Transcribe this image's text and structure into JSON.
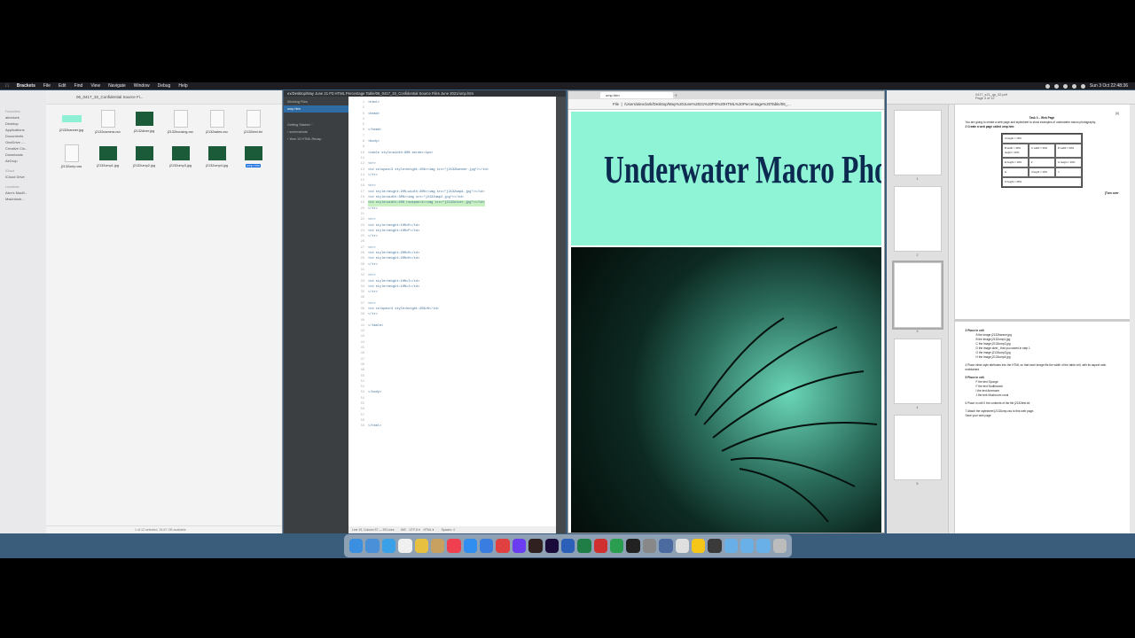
{
  "menubar": {
    "app": "Brackets",
    "items": [
      "File",
      "Edit",
      "Find",
      "View",
      "Navigate",
      "Window",
      "Debug",
      "Help"
    ],
    "clock": "Sun 3 Oct 22:48:36"
  },
  "finder": {
    "path": "06_0417_32_Confidential Source Fi...",
    "favorites_header": "Favourites",
    "favorites": [
      "alexclark",
      "Desktop",
      "Applications",
      "Documents",
      "OneDrive -...",
      "Creative Clo...",
      "Downloads",
      "AirDrop"
    ],
    "icloud_header": "iCloud",
    "icloud": [
      "iCloud Drive"
    ],
    "locations_header": "Locations",
    "locations": [
      "Alex's MacB...",
      "Macintosh..."
    ],
    "files": [
      {
        "name": "j2132banner.jpg",
        "kind": "banner"
      },
      {
        "name": "j2132camera.csv",
        "kind": "doc"
      },
      {
        "name": "j2132diver.jpg",
        "kind": "img"
      },
      {
        "name": "j2132housing.csv",
        "kind": "doc"
      },
      {
        "name": "j2132sales.csv",
        "kind": "doc"
      },
      {
        "name": "j2132text.txt",
        "kind": "doc"
      },
      {
        "name": "j2132ump.css",
        "kind": "doc"
      },
      {
        "name": "j2132ump1.jpg",
        "kind": "img"
      },
      {
        "name": "j2132ump2.jpg",
        "kind": "img"
      },
      {
        "name": "j2132ump3.jpg",
        "kind": "img"
      },
      {
        "name": "j2132ump4.jpg",
        "kind": "img"
      },
      {
        "name": "ump.htm",
        "kind": "img",
        "selected": true
      }
    ],
    "status": "1 of 12 selected, 34.67 GB available"
  },
  "brackets": {
    "title": "ex/Desktop/May June 21 P3 HTML Percentage Table/06_0417_32_Confidential Source Files June 2021/ump.htm",
    "subtitle": "ump.htm — Brackets",
    "working_files_label": "Working Files",
    "open_file": "ump.htm",
    "getting_started": "Getting Started ~",
    "tree": [
      "› screenshots",
      "› Year 10 HTML Recap"
    ],
    "lines": [
      {
        "n": "1",
        "code": "<html>"
      },
      {
        "n": "2",
        "code": ""
      },
      {
        "n": "3",
        "code": "<head>"
      },
      {
        "n": "4",
        "code": ""
      },
      {
        "n": "5",
        "code": ""
      },
      {
        "n": "6",
        "code": "</head>"
      },
      {
        "n": "7",
        "code": ""
      },
      {
        "n": "8",
        "code": "<body>"
      },
      {
        "n": "9",
        "code": ""
      },
      {
        "n": "10",
        "code": "<table style=width:90% border=1px>"
      },
      {
        "n": "11",
        "code": ""
      },
      {
        "n": "12",
        "code": "<tr>"
      },
      {
        "n": "13",
        "code": "<td colspan=3 style=height:15%><img src=\"j2132banner.jpg\"></td>"
      },
      {
        "n": "14",
        "code": "</tr>"
      },
      {
        "n": "15",
        "code": ""
      },
      {
        "n": "16",
        "code": "<tr>"
      },
      {
        "n": "17",
        "code": "<td style=height:20%;width:30%><img src=\"j2132ump1.jpg\"></td>"
      },
      {
        "n": "18",
        "code": "<td style=width:30%><img src=\"j2132ump2.jpg\"></td>"
      },
      {
        "n": "19",
        "code": "<td style=width:40% rowspan=4><img src=\"j2132diver.jpg\"></td>",
        "hl": true
      },
      {
        "n": "20",
        "code": "</tr>"
      },
      {
        "n": "21",
        "code": ""
      },
      {
        "n": "22",
        "code": "<tr>"
      },
      {
        "n": "23",
        "code": "<td style=height:10%>E</td>"
      },
      {
        "n": "24",
        "code": "<td style=height:10%>F</td>"
      },
      {
        "n": "25",
        "code": "</tr>"
      },
      {
        "n": "26",
        "code": ""
      },
      {
        "n": "27",
        "code": "<tr>"
      },
      {
        "n": "28",
        "code": "<td style=height:20%>G</td>"
      },
      {
        "n": "29",
        "code": "<td style=height:20%>H</td>"
      },
      {
        "n": "30",
        "code": "</tr>"
      },
      {
        "n": "31",
        "code": ""
      },
      {
        "n": "32",
        "code": "<tr>"
      },
      {
        "n": "33",
        "code": "<td style=height:10%>I</td>"
      },
      {
        "n": "34",
        "code": "<td style=height:10%>J</td>"
      },
      {
        "n": "35",
        "code": "</tr>"
      },
      {
        "n": "36",
        "code": ""
      },
      {
        "n": "37",
        "code": "<tr>"
      },
      {
        "n": "38",
        "code": "<td colspan=3 style=height:25%>K</td>"
      },
      {
        "n": "39",
        "code": "</tr>"
      },
      {
        "n": "40",
        "code": ""
      },
      {
        "n": "41",
        "code": "</table>"
      },
      {
        "n": "42",
        "code": ""
      },
      {
        "n": "43",
        "code": ""
      },
      {
        "n": "44",
        "code": ""
      },
      {
        "n": "45",
        "code": ""
      },
      {
        "n": "46",
        "code": ""
      },
      {
        "n": "47",
        "code": ""
      },
      {
        "n": "48",
        "code": ""
      },
      {
        "n": "49",
        "code": ""
      },
      {
        "n": "50",
        "code": ""
      },
      {
        "n": "51",
        "code": ""
      },
      {
        "n": "52",
        "code": ""
      },
      {
        "n": "53",
        "code": "</body>"
      },
      {
        "n": "54",
        "code": ""
      },
      {
        "n": "55",
        "code": ""
      },
      {
        "n": "56",
        "code": ""
      },
      {
        "n": "57",
        "code": ""
      },
      {
        "n": "58",
        "code": ""
      },
      {
        "n": "59",
        "code": "</html>"
      }
    ],
    "status": "Line 19, Column 57 — 59 Lines        INS    UTF-8 ▾    HTML ▾         Spaces: 4"
  },
  "browser": {
    "tab": "ump.htm",
    "url_prefix": "File",
    "url": "/Users/alexclark/Desktop/May%20June%2021%20P3%20HTML%20Percentage%20Table/06_...",
    "banner_title": "Underwater Macro Photo"
  },
  "preview": {
    "doc_title": "0417_s21_qp_32.pdf",
    "doc_sub": "Page 3 of 12",
    "page_numbers": [
      "1",
      "2",
      "3",
      "4",
      "5"
    ],
    "task_heading": "Task 3 – Web Page",
    "turn_over": "[Turn over",
    "mark_4": "[4]",
    "intro": "You are going to create a web page and stylesheet to show examples of underwater macro photography.",
    "step2": "2   Create a web page called ump.htm",
    "cells": [
      "A height = 15%",
      "B width = 30% height = 20%",
      "C width = 30%",
      "D width = 40%",
      "E height = 10%",
      "F",
      "G height = 20%",
      "H",
      "I height = 10%",
      "J",
      "K height = 25%"
    ],
    "step3": "3   Place in cell:",
    "step3_items": [
      "A the image j2132banner.jpg",
      "B the image j2132ump1.jpg",
      "C the image j2132ump2.jpg",
      "D the image diver_ that you saved in step 1",
      "G the image j2132ump3.jpg",
      "H the image j2132ump4.jpg"
    ],
    "step4": "4   Place inline style attributes into the HTML so that each image fits the width of the table cell, with its aspect ratio maintained.",
    "step5": "5   Place in cell:",
    "step5_items": [
      "F the text Sponge",
      "F the text Nudibranch",
      "I the text Anemone",
      "J the text Mushroom coral"
    ],
    "step6": "6   Place in cell K the contents of the file j2132text.txt",
    "step7": "7   Attach the stylesheet j2132ump.css to this web page.",
    "save": "Save your web page."
  }
}
